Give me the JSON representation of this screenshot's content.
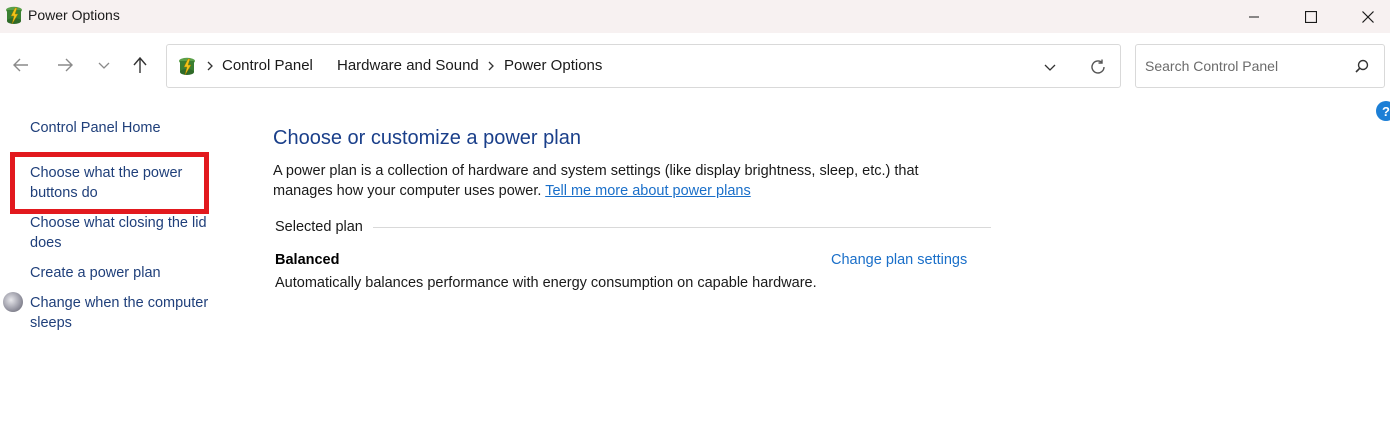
{
  "window": {
    "title": "Power Options"
  },
  "address_bar": {
    "crumbs": [
      "Control Panel",
      "Hardware and Sound",
      "Power Options"
    ]
  },
  "search": {
    "placeholder": "Search Control Panel"
  },
  "sidebar": {
    "items": [
      {
        "label": "Control Panel Home"
      },
      {
        "label": "Choose what the power buttons do"
      },
      {
        "label": "Choose what closing the lid does"
      },
      {
        "label": "Create a power plan"
      },
      {
        "label": "Change when the computer sleeps"
      }
    ]
  },
  "main": {
    "title": "Choose or customize a power plan",
    "description": "A power plan is a collection of hardware and system settings (like display brightness, sleep, etc.) that manages how your computer uses power.",
    "learn_more_link": "Tell me more about power plans",
    "selected_plan_label": "Selected plan",
    "plan_name": "Balanced",
    "change_plan_link": "Change plan settings",
    "plan_description": "Automatically balances performance with energy consumption on capable hardware."
  },
  "help": {
    "glyph": "?"
  },
  "colors": {
    "link": "#1f3f7a",
    "highlight": "#e2191e",
    "title": "#1a3f8a"
  }
}
